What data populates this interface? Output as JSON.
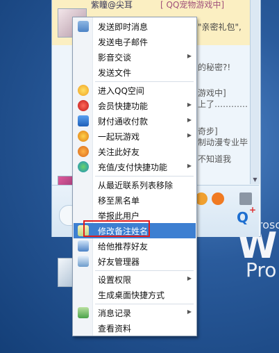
{
  "wallpaper": {
    "small_text": "rosc",
    "big_text": "W",
    "pro_text": "Pro"
  },
  "qq_window": {
    "contact_name": "紫瞳@尖耳",
    "contact_tag": "[ QQ宠物游戏中]",
    "gift_text": "\"亲密礼包\",",
    "secret_text": "的秘密?!",
    "game_text": "游戏中]",
    "last_text": "上了…………",
    "step_text": "奇步]",
    "anim_text": "制动漫专业毕",
    "unknown_text": "不知道我"
  },
  "menu": {
    "items": [
      {
        "label": "发送即时消息",
        "icon": "message-icon",
        "submenu": false
      },
      {
        "label": "发送电子邮件",
        "icon": "",
        "submenu": false
      },
      {
        "label": "影音交谈",
        "icon": "",
        "submenu": true
      },
      {
        "label": "发送文件",
        "icon": "",
        "submenu": false
      },
      {
        "label": "进入QQ空间",
        "icon": "qzone-icon",
        "submenu": false
      },
      {
        "label": "会员快捷功能",
        "icon": "vip-icon",
        "submenu": true
      },
      {
        "label": "财付通收付款",
        "icon": "tenpay-icon",
        "submenu": true
      },
      {
        "label": "一起玩游戏",
        "icon": "game-icon",
        "submenu": true
      },
      {
        "label": "关注此好友",
        "icon": "care-icon",
        "submenu": false
      },
      {
        "label": "充值/支付快捷功能",
        "icon": "recharge-icon",
        "submenu": true
      },
      {
        "label": "从最近联系列表移除",
        "icon": "",
        "submenu": false
      },
      {
        "label": "移至黑名单",
        "icon": "",
        "submenu": false
      },
      {
        "label": "举报此用户",
        "icon": "",
        "submenu": false
      },
      {
        "label": "修改备注姓名",
        "icon": "edit-note-icon",
        "submenu": false
      },
      {
        "label": "给他推荐好友",
        "icon": "recommend-icon",
        "submenu": false
      },
      {
        "label": "好友管理器",
        "icon": "friend-manager-icon",
        "submenu": false
      },
      {
        "label": "设置权限",
        "icon": "",
        "submenu": true
      },
      {
        "label": "生成桌面快捷方式",
        "icon": "",
        "submenu": false
      },
      {
        "label": "消息记录",
        "icon": "history-icon",
        "submenu": true
      },
      {
        "label": "查看资料",
        "icon": "",
        "submenu": false
      }
    ],
    "highlighted_label": "修改备注姓名"
  },
  "colors": {
    "highlight": "#3d7fd1",
    "annotation_box": "#e01b1b",
    "row_selected": "#fbefc2"
  }
}
